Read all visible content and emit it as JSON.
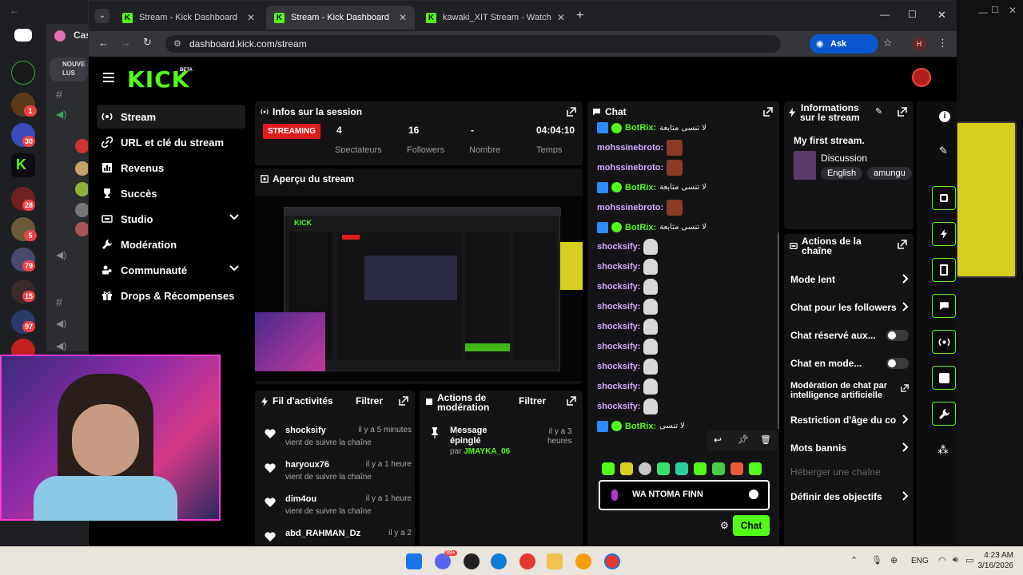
{
  "browser": {
    "tabs": [
      {
        "label": "Stream - Kick Dashboard",
        "active": false
      },
      {
        "label": "Stream - Kick Dashboard",
        "active": true
      },
      {
        "label": "kawaki_XIT Stream - Watch Live",
        "active": false
      }
    ],
    "url": "dashboard.kick.com/stream",
    "ask_google": "Ask Google",
    "profile_initial": "H"
  },
  "discord": {
    "server_label": "Cas",
    "new_label_1": "NOUVE",
    "new_label_2": "LUS",
    "badges": [
      "1",
      "30",
      "28",
      "5",
      "79",
      "15",
      "97"
    ],
    "brand_color": "#5865f2"
  },
  "kick": {
    "logo": "KICK",
    "beta": "BETA",
    "accent": "#53fc18",
    "nav": [
      {
        "label": "Stream",
        "icon": "broadcast-icon",
        "active": true
      },
      {
        "label": "URL et clé du stream",
        "icon": "link-icon"
      },
      {
        "label": "Revenus",
        "icon": "chart-icon"
      },
      {
        "label": "Succès",
        "icon": "trophy-icon"
      },
      {
        "label": "Studio",
        "icon": "studio-icon",
        "expandable": true
      },
      {
        "label": "Modération",
        "icon": "wrench-icon"
      },
      {
        "label": "Communauté",
        "icon": "community-icon",
        "expandable": true
      },
      {
        "label": "Drops & Récompenses",
        "icon": "gift-icon"
      }
    ],
    "session": {
      "title": "Infos sur la session",
      "badge": "STREAMING",
      "stats": [
        {
          "value": "4",
          "label": "Spectateurs"
        },
        {
          "value": "16",
          "label": "Followers"
        },
        {
          "value": "-",
          "label": "Nombre"
        },
        {
          "value": "04:04:10",
          "label": "Temps"
        }
      ]
    },
    "preview": {
      "title": "Aperçu du stream"
    },
    "activity": {
      "title": "Fil d'activités",
      "filter": "Filtrer",
      "items": [
        {
          "name": "shocksify",
          "time": "il y a 5 minutes",
          "sub": "vient de suivre la chaîne"
        },
        {
          "name": "haryoux76",
          "time": "il y a 1 heure",
          "sub": "vient de suivre la chaîne"
        },
        {
          "name": "dim4ou",
          "time": "il y a 1 heure",
          "sub": "vient de suivre la chaîne"
        },
        {
          "name": "abd_RAHMAN_Dz",
          "time": "il y a 2",
          "sub": ""
        }
      ]
    },
    "modactions": {
      "title_1": "Actions de",
      "title_2": "modération",
      "filter": "Filtrer",
      "item_title_1": "Message",
      "item_title_2": "épinglé",
      "item_by": "par",
      "item_user": "JMAYKA_06",
      "item_time_1": "il y a 3",
      "item_time_2": "heures"
    },
    "chat": {
      "title": "Chat",
      "messages": [
        {
          "user": "BotRix:",
          "bot": true,
          "text": "لا تنسى متابعة"
        },
        {
          "user": "mohssinebroto:",
          "emote": "face"
        },
        {
          "user": "mohssinebroto:",
          "emote": "face"
        },
        {
          "user": "BotRix:",
          "bot": true,
          "text": "لا تنسى متابعة"
        },
        {
          "user": "mohssinebroto:",
          "emote": "face"
        },
        {
          "user": "BotRix:",
          "bot": true,
          "text": "لا تنسى متابعة"
        },
        {
          "user": "shocksify:",
          "emote": "skull"
        },
        {
          "user": "shocksify:",
          "emote": "skull"
        },
        {
          "user": "shocksify:",
          "emote": "skull"
        },
        {
          "user": "shocksify:",
          "emote": "skull"
        },
        {
          "user": "shocksify:",
          "emote": "skull"
        },
        {
          "user": "shocksify:",
          "emote": "skull"
        },
        {
          "user": "shocksify:",
          "emote": "skull"
        },
        {
          "user": "shocksify:",
          "emote": "skull"
        },
        {
          "user": "shocksify:",
          "emote": "skull"
        },
        {
          "user": "BotRix:",
          "bot": true,
          "text": "لا تنسى"
        }
      ],
      "input_value": "WA NTOMA FINN",
      "send_label": "Chat"
    },
    "stream_info": {
      "title_1": "Informations",
      "title_2": "sur le stream",
      "stream_title": "My first stream.",
      "category": "Discussion",
      "tags": [
        "English",
        "amungu"
      ]
    },
    "channel_actions": {
      "title_1": "Actions de la",
      "title_2": "chaîne",
      "items": [
        {
          "label": "Mode lent",
          "type": "chevron"
        },
        {
          "label": "Chat pour les followers",
          "type": "chevron"
        },
        {
          "label": "Chat réservé aux...",
          "type": "toggle"
        },
        {
          "label": "Chat en mode...",
          "type": "toggle"
        },
        {
          "label": "Modération de chat par intelligence artificielle",
          "type": "external"
        },
        {
          "label": "Restriction d'âge du co",
          "type": "chevron"
        },
        {
          "label": "Mots bannis",
          "type": "chevron"
        },
        {
          "label": "Héberger une chaîne",
          "type": "disabled"
        },
        {
          "label": "Définir des objectifs",
          "type": "chevron"
        }
      ]
    }
  },
  "taskbar": {
    "time": "4:23 AM",
    "date": "3/16/2026",
    "lang": "ENG",
    "notif_badge": "99+"
  }
}
